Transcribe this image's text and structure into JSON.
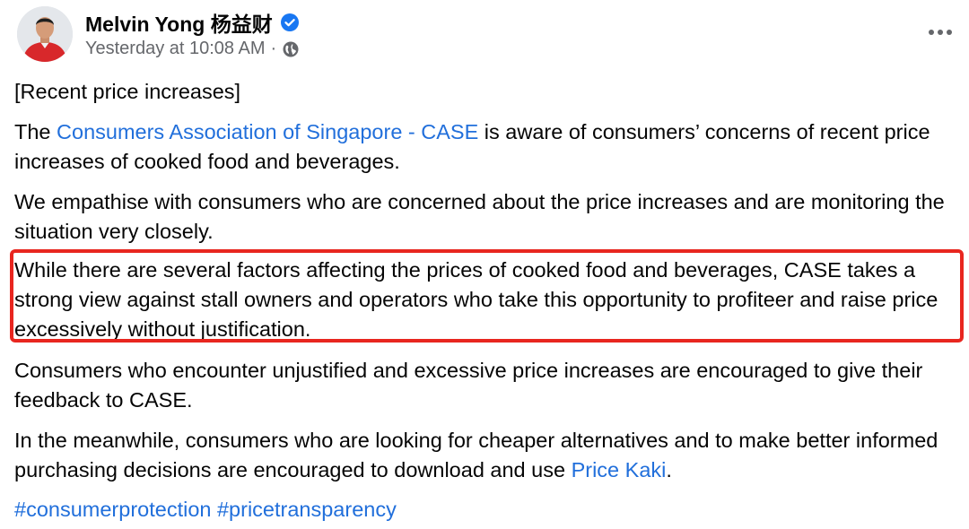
{
  "post": {
    "author": "Melvin Yong 杨益财",
    "timestamp": "Yesterday at 10:08 AM",
    "separator": "·",
    "body": {
      "heading": "[Recent price increases]",
      "para1_prefix": "The ",
      "para1_link": "Consumers Association of Singapore - CASE",
      "para1_suffix": "  is aware of consumers’ concerns of recent price increases of cooked food and beverages.",
      "para2": "We empathise with consumers who are concerned about the price increases and are monitoring the situation very closely.",
      "para3": "While there are several factors affecting the prices of cooked food and beverages, CASE takes a strong view against stall owners and operators who take this opportunity to profiteer and raise price excessively without justification.",
      "para4": "Consumers who encounter unjustified and excessive price increases are encouraged to give their feedback to CASE.",
      "para5_prefix": "In the meanwhile, consumers who are looking for cheaper alternatives and to make better informed purchasing decisions are encouraged to download and use ",
      "para5_link": "Price Kaki",
      "para5_suffix": ".",
      "hashtags": [
        "#consumerprotection",
        "#pricetransparency"
      ]
    }
  },
  "icons": {
    "verified": "verified-badge-icon",
    "audience": "globe-icon",
    "menu": "more-options-icon"
  },
  "colors": {
    "link": "#216fdb",
    "highlight_border": "#e8261f",
    "verified": "#1877f2",
    "meta_text": "#65676b"
  }
}
